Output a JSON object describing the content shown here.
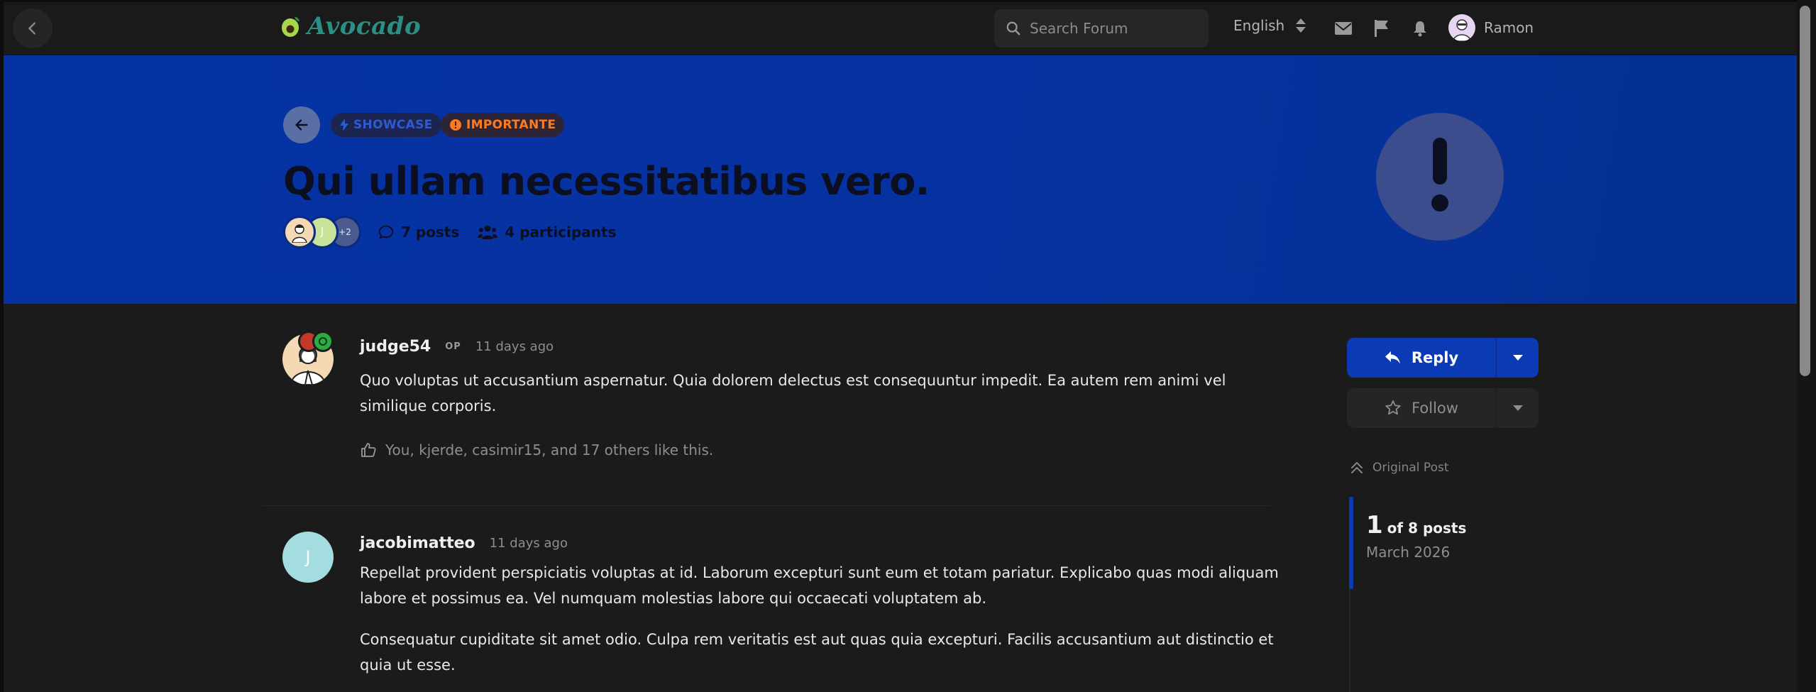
{
  "header": {
    "logo_text": "Avocado",
    "search_placeholder": "Search Forum",
    "language": "English",
    "user_name": "Ramon"
  },
  "discussion": {
    "tags": [
      {
        "label": "SHOWCASE",
        "color": "#2d5bd6"
      },
      {
        "label": "IMPORTANTE",
        "color": "#ff7a1a"
      }
    ],
    "title": "Qui ullam necessitatibus vero.",
    "more_participants": "+2",
    "avatar_letter": "J",
    "posts_count": "7 posts",
    "participants_count": "4 participants",
    "hero_color": "#0532a3"
  },
  "posts": [
    {
      "username": "judge54",
      "op_badge": "OP",
      "time": "11 days ago",
      "paragraphs": [
        "Quo voluptas ut accusantium aspernatur. Quia dolorem delectus est consequuntur impedit. Ea autem rem animi vel similique corporis."
      ],
      "likes": "You, kjerde, casimir15, and 17 others like this."
    },
    {
      "username": "jacobimatteo",
      "avatar_letter": "J",
      "time": "11 days ago",
      "paragraphs": [
        "Repellat provident perspiciatis voluptas at id. Laborum excepturi sunt eum et totam pariatur. Explicabo quas modi aliquam labore et possimus ea. Vel numquam molestias labore qui occaecati voluptatem ab.",
        "Consequatur cupiditate sit amet odio. Culpa rem veritatis est aut quas quia excepturi. Facilis accusantium aut distinctio et quia ut esse."
      ]
    }
  ],
  "sidebar": {
    "reply_label": "Reply",
    "follow_label": "Follow",
    "original_post_label": "Original Post",
    "scrubber_index": "1",
    "scrubber_of": "of 8 posts",
    "scrubber_date": "March 2026"
  }
}
